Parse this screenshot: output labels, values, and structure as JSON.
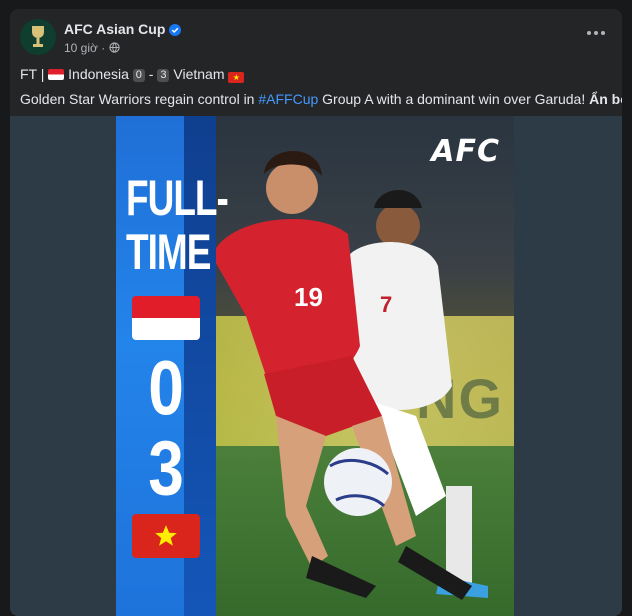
{
  "post": {
    "page_name": "AFC Asian Cup",
    "time": "10 giờ",
    "line1": {
      "prefix": "FT |",
      "home_team": "Indonesia",
      "home_score": "0",
      "separator": "-",
      "away_score": "3",
      "away_team": "Vietnam"
    },
    "line2": {
      "text_before": "Golden Star Warriors regain control in ",
      "hashtag": "#AFFCup",
      "text_after": " Group A with a dominant win over Garuda!",
      "see_less": "Ẩn bớt"
    }
  },
  "graphic": {
    "title_line1": "FULL-",
    "title_line2": "TIME",
    "home_score": "0",
    "away_score": "3",
    "logo": "AFC",
    "player_number_home": "19",
    "player_number_away": "7",
    "board_text": "NG",
    "colors": {
      "band": "#2384ea",
      "indonesia_red": "#e21d2a",
      "vietnam_red": "#da251d",
      "vietnam_star": "#ffec00"
    }
  },
  "icons": {
    "verified": "verified-badge-icon",
    "globe": "globe-icon",
    "more": "more-options-icon"
  }
}
